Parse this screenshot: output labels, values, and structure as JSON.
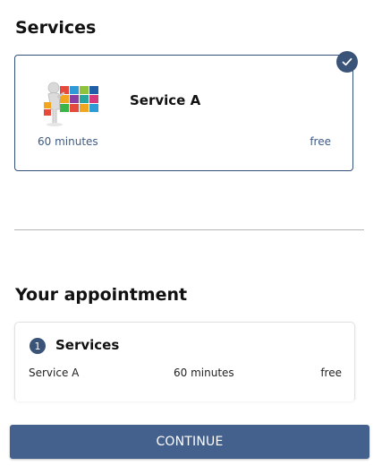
{
  "services_section": {
    "title": "Services",
    "selected_service": {
      "name": "Service A",
      "duration": "60 minutes",
      "price": "free",
      "selected": true
    }
  },
  "appointment_section": {
    "title": "Your appointment",
    "summary": {
      "step_number": "1",
      "heading": "Services",
      "rows": [
        {
          "service": "Service A",
          "duration": "60 minutes",
          "price": "free"
        }
      ]
    }
  },
  "footer": {
    "continue_label": "CONTINUE"
  },
  "colors": {
    "accent": "#3a5379",
    "button": "#44608c",
    "card_border": "#34507a"
  },
  "icons": {
    "selected": "checkmark-icon",
    "service": "service-illustration"
  }
}
